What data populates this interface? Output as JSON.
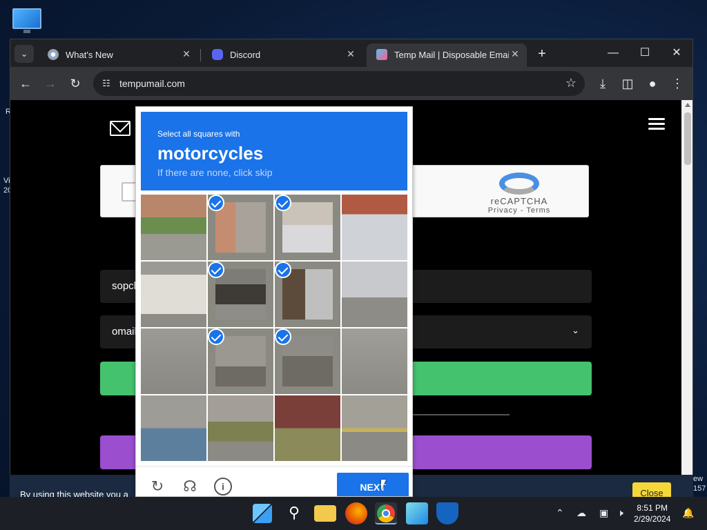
{
  "desktop": {
    "left_partial_1": "R",
    "left_partial_2": "Vi",
    "left_partial_3": "20",
    "right_partial_1": "ew",
    "right_partial_2": "157"
  },
  "browser": {
    "tabs": [
      {
        "title": "What's New",
        "icon": "chrome-icon"
      },
      {
        "title": "Discord",
        "icon": "discord-icon"
      },
      {
        "title": "Temp Mail | Disposable Email Ad",
        "icon": "tempmail-icon",
        "active": true
      }
    ],
    "new_tab_label": "+",
    "url": "tempumail.com"
  },
  "page": {
    "field_name": "sopck",
    "field_domain": "omail",
    "recaptcha_name": "reCAPTCHA",
    "recaptcha_links": "Privacy - Terms",
    "cookie_text": "By using this website you a",
    "cookie_close": "Close"
  },
  "challenge": {
    "line1": "Select all squares with",
    "line2": "motorcycles",
    "line3": "If there are none, click skip",
    "selected": [
      false,
      true,
      true,
      false,
      false,
      true,
      true,
      false,
      false,
      true,
      true,
      false,
      false,
      false,
      false,
      false
    ],
    "next_label": "NEXT"
  },
  "taskbar": {
    "time": "8:51 PM",
    "date": "2/29/2024"
  },
  "colors": {
    "accent": "#1a73e8",
    "green_button": "#45c26d",
    "purple_button": "#9b4fcf",
    "cookie_close": "#f5d73a"
  }
}
